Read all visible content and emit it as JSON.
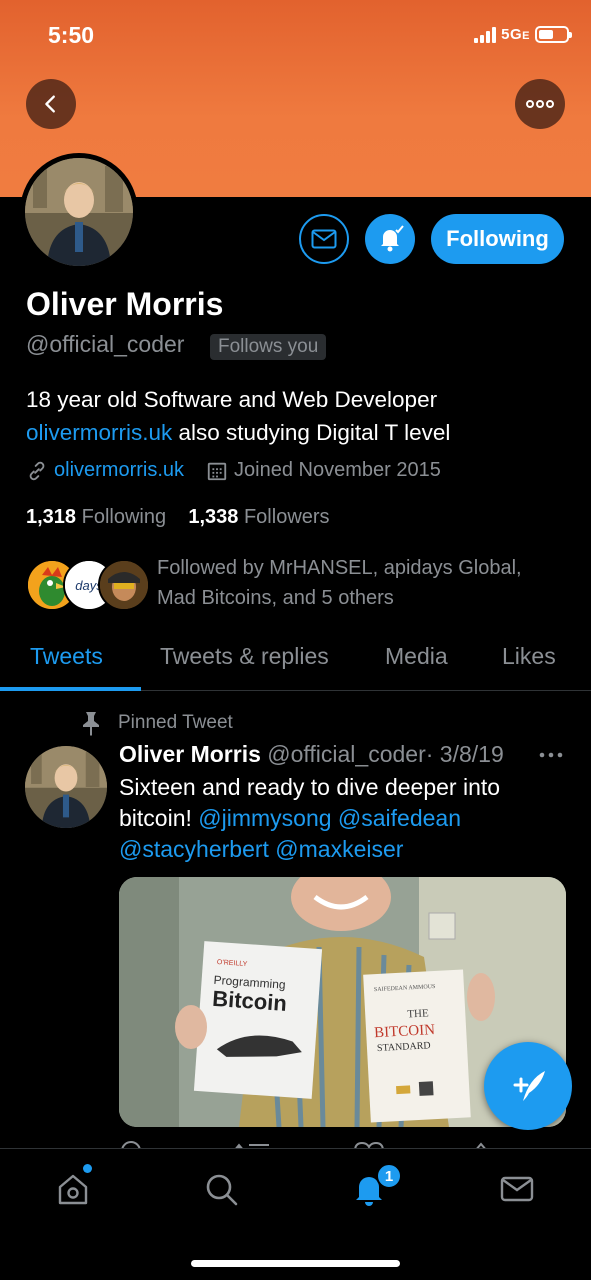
{
  "status_bar": {
    "time": "5:50",
    "network": "5G",
    "network_suffix": "E"
  },
  "profile": {
    "name": "Oliver Morris",
    "handle": "@official_coder",
    "follows_you": "Follows you",
    "bio_line1": "18 year old Software and Web Developer",
    "bio_link": "olivermorris.uk",
    "bio_line2_rest": " also studying Digital T level",
    "website": "olivermorris.uk",
    "joined": "Joined November 2015",
    "following_count": "1,318",
    "following_label": "Following",
    "followers_count": "1,338",
    "followers_label": "Followers",
    "followed_by_line1": "Followed by MrHANSEL, apidays Global,",
    "followed_by_line2": "Mad Bitcoins, and 5 others",
    "follower_avatar_text": "days"
  },
  "actions": {
    "following_label": "Following"
  },
  "tabs": [
    {
      "label": "Tweets",
      "active": true
    },
    {
      "label": "Tweets & replies"
    },
    {
      "label": "Media"
    },
    {
      "label": "Likes"
    }
  ],
  "tweet": {
    "pinned_label": "Pinned Tweet",
    "author": "Oliver Morris",
    "handle": "@official_coder",
    "date": "· 3/8/19",
    "text_line1": "Sixteen and ready to dive deeper into",
    "text_line2_plain": "bitcoin! ",
    "mention1": "@jimmysong",
    "mention2": "@saifedean",
    "mention3": "@stacyherbert",
    "mention4": "@maxkeiser",
    "book1_publisher": "O'REILLY",
    "book1_title_a": "Programming",
    "book1_title_b": "Bitcoin",
    "book2_author": "SAIFEDEAN AMMOUS",
    "book2_title_a": "THE",
    "book2_title_b": "BITCOIN",
    "book2_title_c": "STANDARD"
  },
  "bottom_nav": {
    "notifications_badge": "1"
  },
  "colors": {
    "accent": "#1d9bf0",
    "banner": "#ef7a3f",
    "muted": "#8b8f94"
  },
  "icons": [
    "back-icon",
    "more-icon",
    "mail-icon",
    "bell-icon",
    "link-icon",
    "calendar-icon",
    "pin-icon",
    "compose-icon",
    "home-icon",
    "search-icon",
    "notifications-icon",
    "messages-icon"
  ]
}
